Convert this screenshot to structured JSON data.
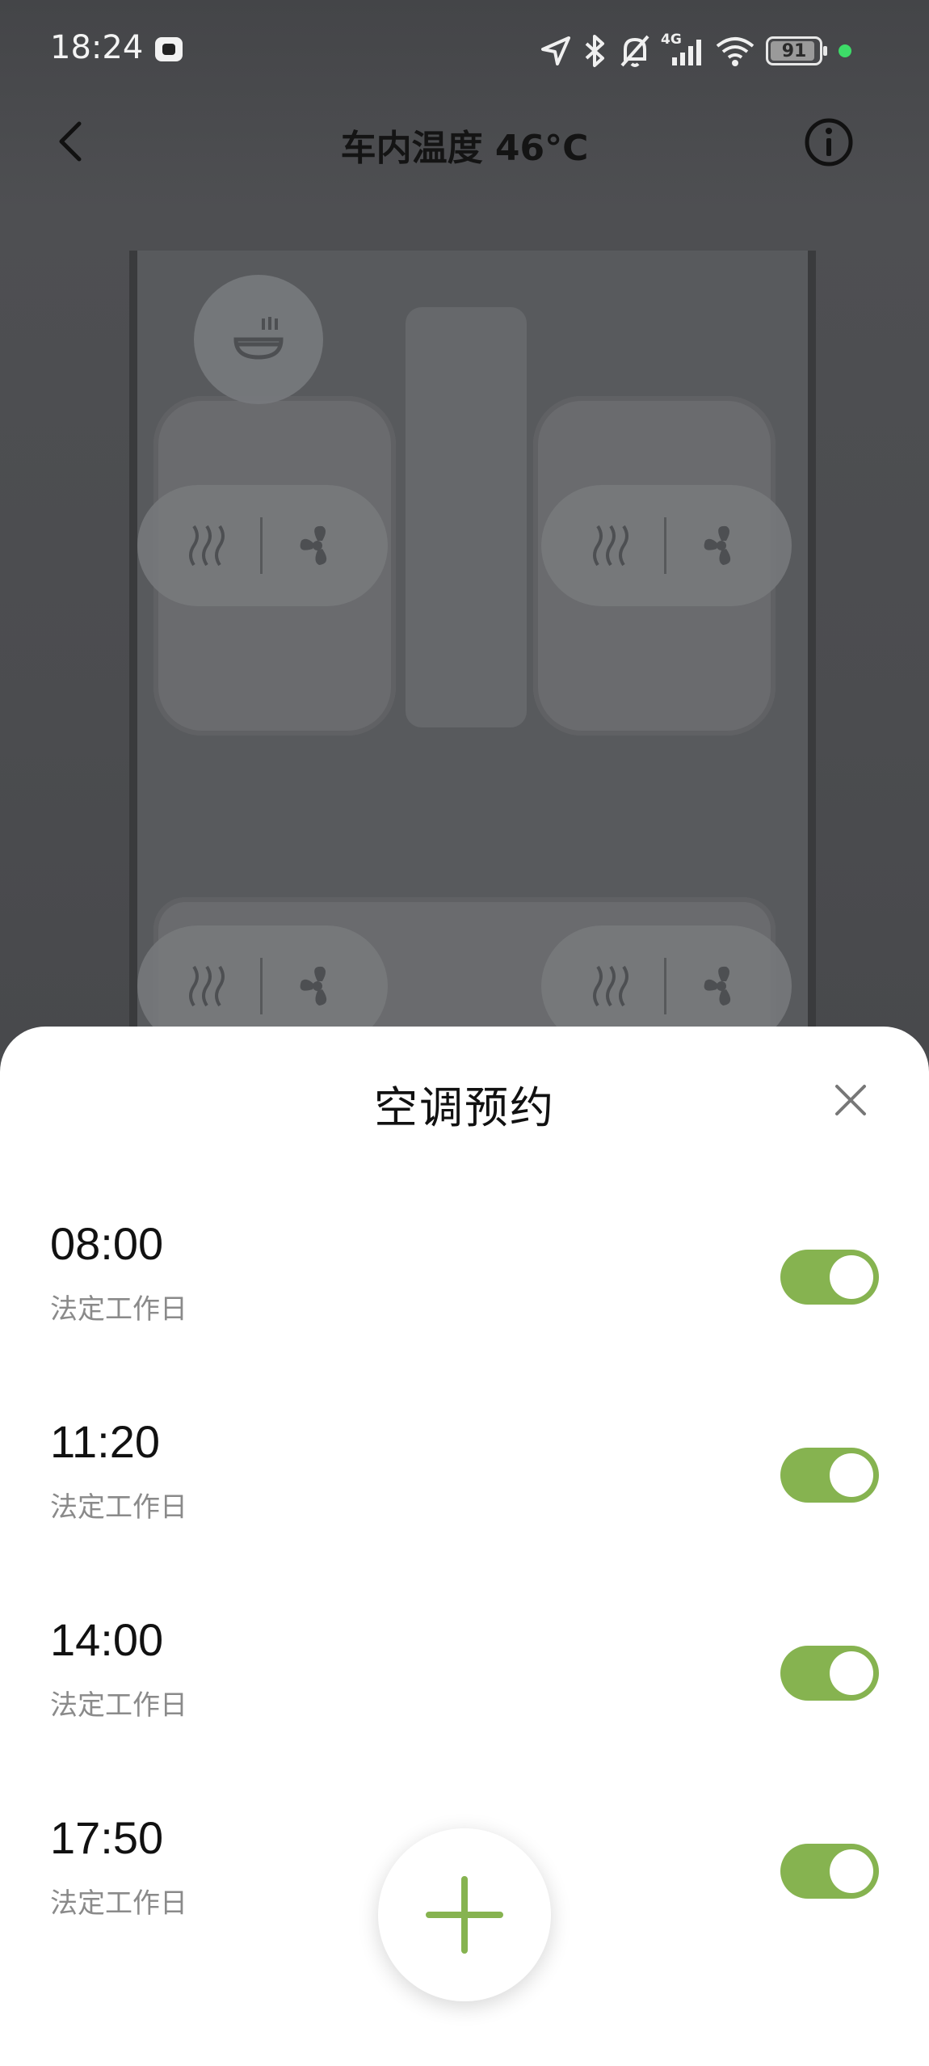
{
  "status_bar": {
    "time": "18:24",
    "network": "4G",
    "battery": "91"
  },
  "header": {
    "title": "车内温度 46°C"
  },
  "sheet": {
    "title": "空调预约",
    "schedules": [
      {
        "time": "08:00",
        "repeat": "法定工作日",
        "enabled": true
      },
      {
        "time": "11:20",
        "repeat": "法定工作日",
        "enabled": true
      },
      {
        "time": "14:00",
        "repeat": "法定工作日",
        "enabled": true
      },
      {
        "time": "17:50",
        "repeat": "法定工作日",
        "enabled": true
      }
    ]
  },
  "colors": {
    "accent": "#86b350",
    "status_dot": "#3ddc68"
  },
  "icons": [
    "back-icon",
    "info-icon",
    "close-icon",
    "plus-icon",
    "seat-heat-icon",
    "seat-fan-icon",
    "steering-heat-icon"
  ]
}
